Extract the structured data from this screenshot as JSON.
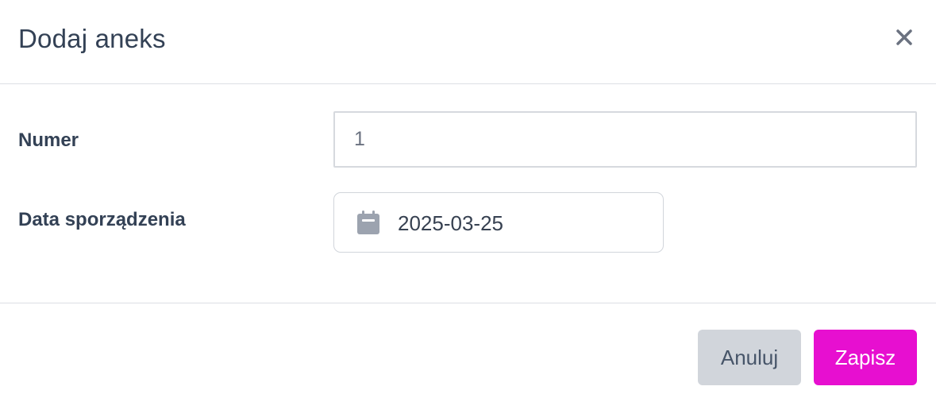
{
  "dialog": {
    "title": "Dodaj aneks",
    "close_icon": "close-icon"
  },
  "form": {
    "number": {
      "label": "Numer",
      "value": "1"
    },
    "date": {
      "label": "Data sporządzenia",
      "value": "2025-03-25",
      "icon": "calendar-icon"
    }
  },
  "actions": {
    "cancel_label": "Anuluj",
    "save_label": "Zapisz"
  },
  "colors": {
    "primary": "#e70fd0",
    "secondary": "#d1d5db",
    "text": "#334155"
  }
}
